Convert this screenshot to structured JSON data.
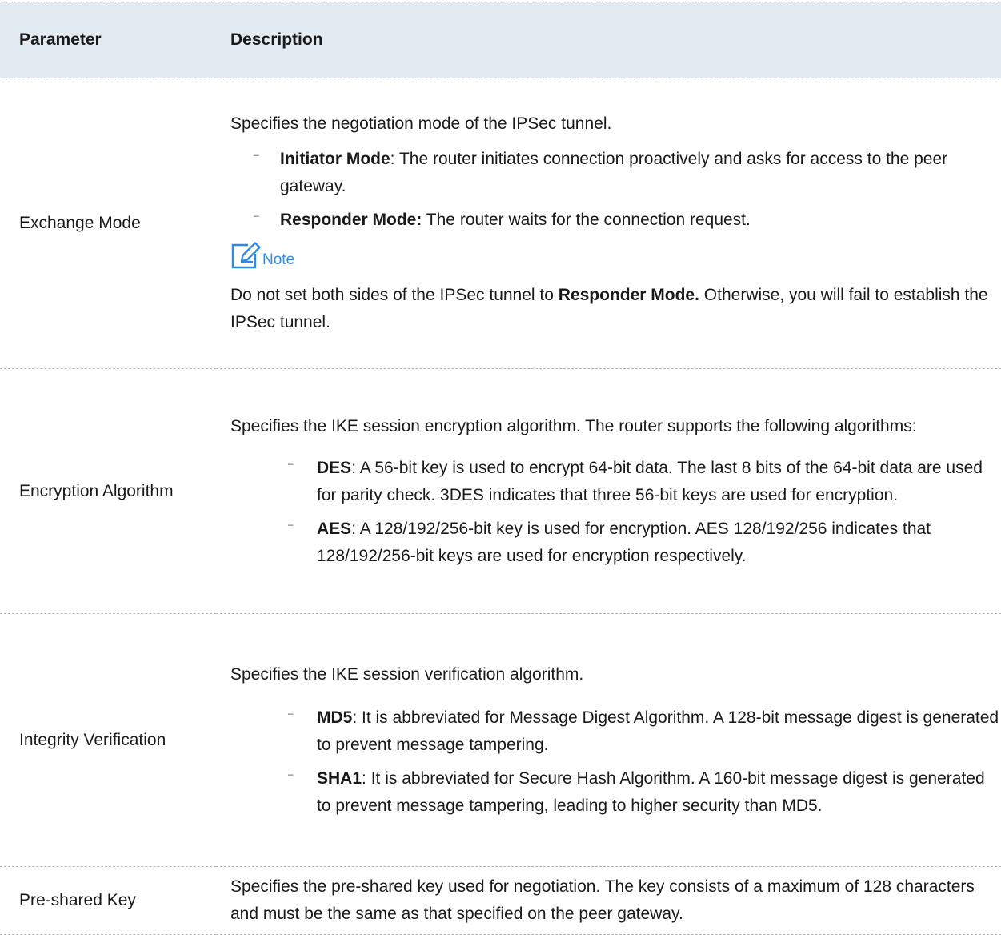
{
  "header": {
    "parameter": "Parameter",
    "description": "Description"
  },
  "rows": [
    {
      "param": "Exchange Mode",
      "intro": "Specifies the negotiation mode of the IPSec tunnel.",
      "bullets": [
        {
          "dash": "–",
          "term": "Initiator Mode",
          "text": ": The router initiates connection proactively and asks for access to the peer gateway."
        },
        {
          "dash": "–",
          "term": "Responder Mode:",
          "text": " The router waits for the connection request."
        }
      ],
      "note": {
        "icon": "note-pen-icon",
        "label": "Note",
        "text_before": "Do not set both sides of the IPSec tunnel to ",
        "text_bold": "Responder Mode.",
        "text_after": " Otherwise, you will fail to establish the IPSec tunnel."
      }
    },
    {
      "param": "Encryption Algorithm",
      "intro": "Specifies the IKE session encryption algorithm. The router supports the following algorithms:",
      "bullets": [
        {
          "dash": "–",
          "term": "DES",
          "text": ": A 56-bit key is used to encrypt 64-bit data. The last 8 bits of the 64-bit data are used for parity check. 3DES indicates that three 56-bit keys are used for encryption."
        },
        {
          "dash": "–",
          "term": "AES",
          "text": ": A 128/192/256-bit key is used for encryption. AES 128/192/256 indicates that 128/192/256-bit keys are used for encryption respectively."
        }
      ]
    },
    {
      "param": "Integrity Verification",
      "intro": "Specifies the IKE session verification algorithm.",
      "bullets": [
        {
          "dash": "–",
          "term": "MD5",
          "text": ": It is abbreviated for Message Digest Algorithm. A 128-bit message digest is generated to prevent message tampering."
        },
        {
          "dash": "–",
          "term": "SHA1",
          "text": ": It is abbreviated for Secure Hash Algorithm. A 160-bit message digest is generated to prevent message tampering, leading to higher security than MD5."
        }
      ]
    },
    {
      "param": "Pre-shared Key",
      "intro": "Specifies the pre-shared key used for negotiation. The key consists of a maximum of 128 characters and must be the same as that specified on the peer gateway."
    }
  ],
  "colors": {
    "header_bg": "#e3ebf2",
    "note_blue": "#2c8be6",
    "divider": "#b5b5b5"
  }
}
